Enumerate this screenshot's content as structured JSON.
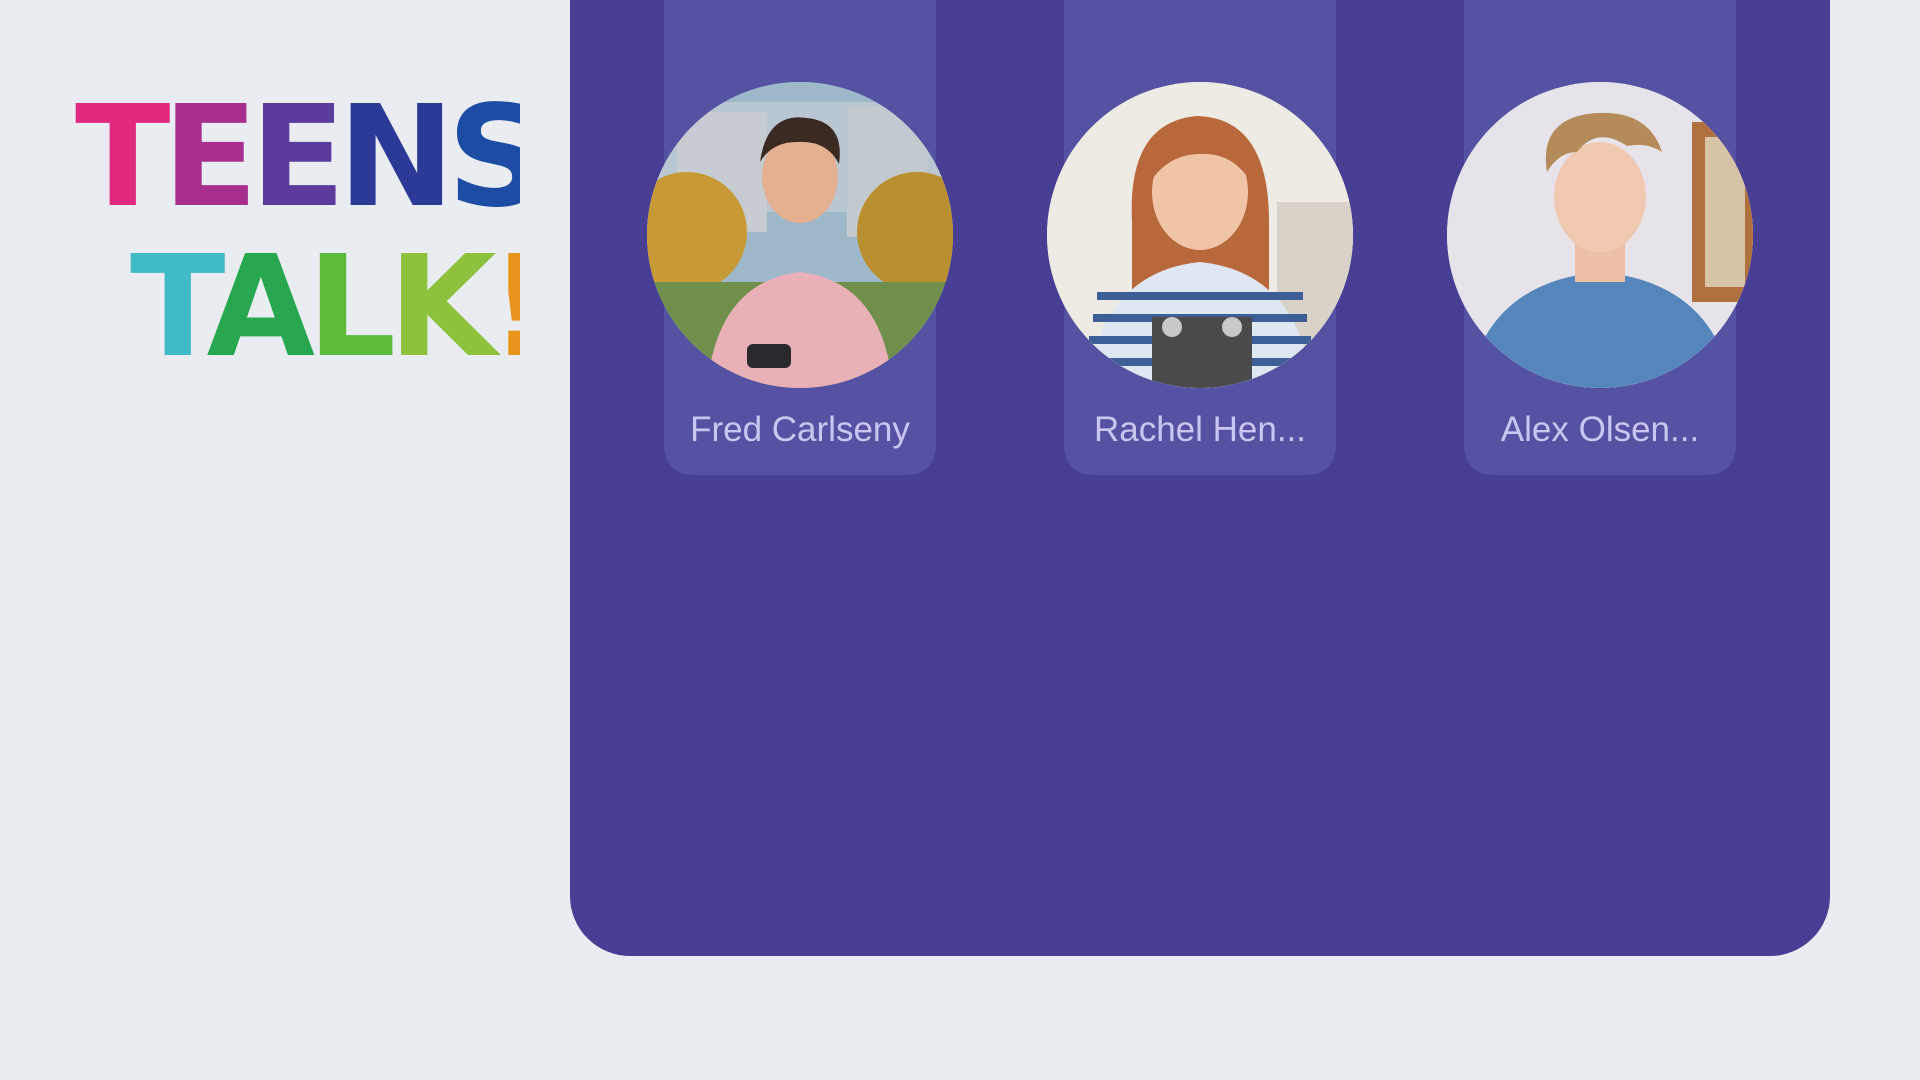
{
  "brand": {
    "logo_line1": "TEENS",
    "logo_line2": "TALK!",
    "colors": {
      "T": "#e0287f",
      "E1": "#a72e8f",
      "E2": "#5b3c9c",
      "N": "#2b3a96",
      "S": "#1c4ca3",
      "T2": "#3fbac6",
      "A": "#28a84e",
      "L": "#5dbb3a",
      "K": "#8cc23c",
      "EXCL": "#e8951c"
    }
  },
  "colors": {
    "background": "#e9ecf1",
    "panel": "#473f94",
    "card": "#5552a3",
    "name_text": "#c9c6f0"
  },
  "participants": [
    {
      "name": "Fred Carlseny",
      "photo": "teen-boy-pink-hoodie-photo"
    },
    {
      "name": "Rachel Hen...",
      "photo": "teen-girl-striped-shirt-photo"
    },
    {
      "name": "Alex Olsen...",
      "photo": "teen-boy-blue-tshirt-photo"
    }
  ]
}
